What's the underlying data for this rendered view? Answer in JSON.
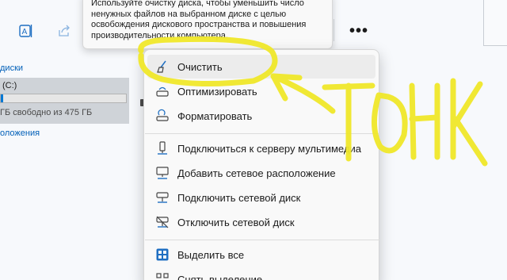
{
  "tooltip": {
    "lines": [
      "Используйте очистку диска, чтобы уменьшить число",
      "ненужных файлов на выбранном диске с целью",
      "освобождения дискового пространства и повышения",
      "производительности компьютера."
    ]
  },
  "toolbar": {
    "rename_icon": "rename-icon",
    "share_icon": "share-icon",
    "more_label": "•••"
  },
  "left_pane": {
    "devices_heading": "диски",
    "drive": {
      "name": "(C:)",
      "free_text": "ГБ свободно из 475 ГБ",
      "used_fraction": 0.02
    },
    "network_heading": "оложения"
  },
  "context_menu": {
    "items": [
      {
        "label": "Очистить",
        "icon": "disk-cleanup-icon"
      },
      {
        "label": "Оптимизировать",
        "icon": "optimize-drive-icon"
      },
      {
        "label": "Форматировать",
        "icon": "format-drive-icon"
      },
      {
        "label": "Подключиться к серверу мультимедиа",
        "icon": "media-server-icon"
      },
      {
        "label": "Добавить сетевое расположение",
        "icon": "network-location-icon"
      },
      {
        "label": "Подключить сетевой диск",
        "icon": "map-network-drive-icon"
      },
      {
        "label": "Отключить сетевой диск",
        "icon": "disconnect-network-drive-icon"
      },
      {
        "label": "Выделить все",
        "icon": "select-all-icon"
      },
      {
        "label": "Снять выделение",
        "icon": "select-none-icon"
      }
    ]
  },
  "colors": {
    "accent": "#0078d4",
    "link": "#005fb8",
    "highlighter": "#f0e82a",
    "menu_background": "#f9f9f9"
  }
}
